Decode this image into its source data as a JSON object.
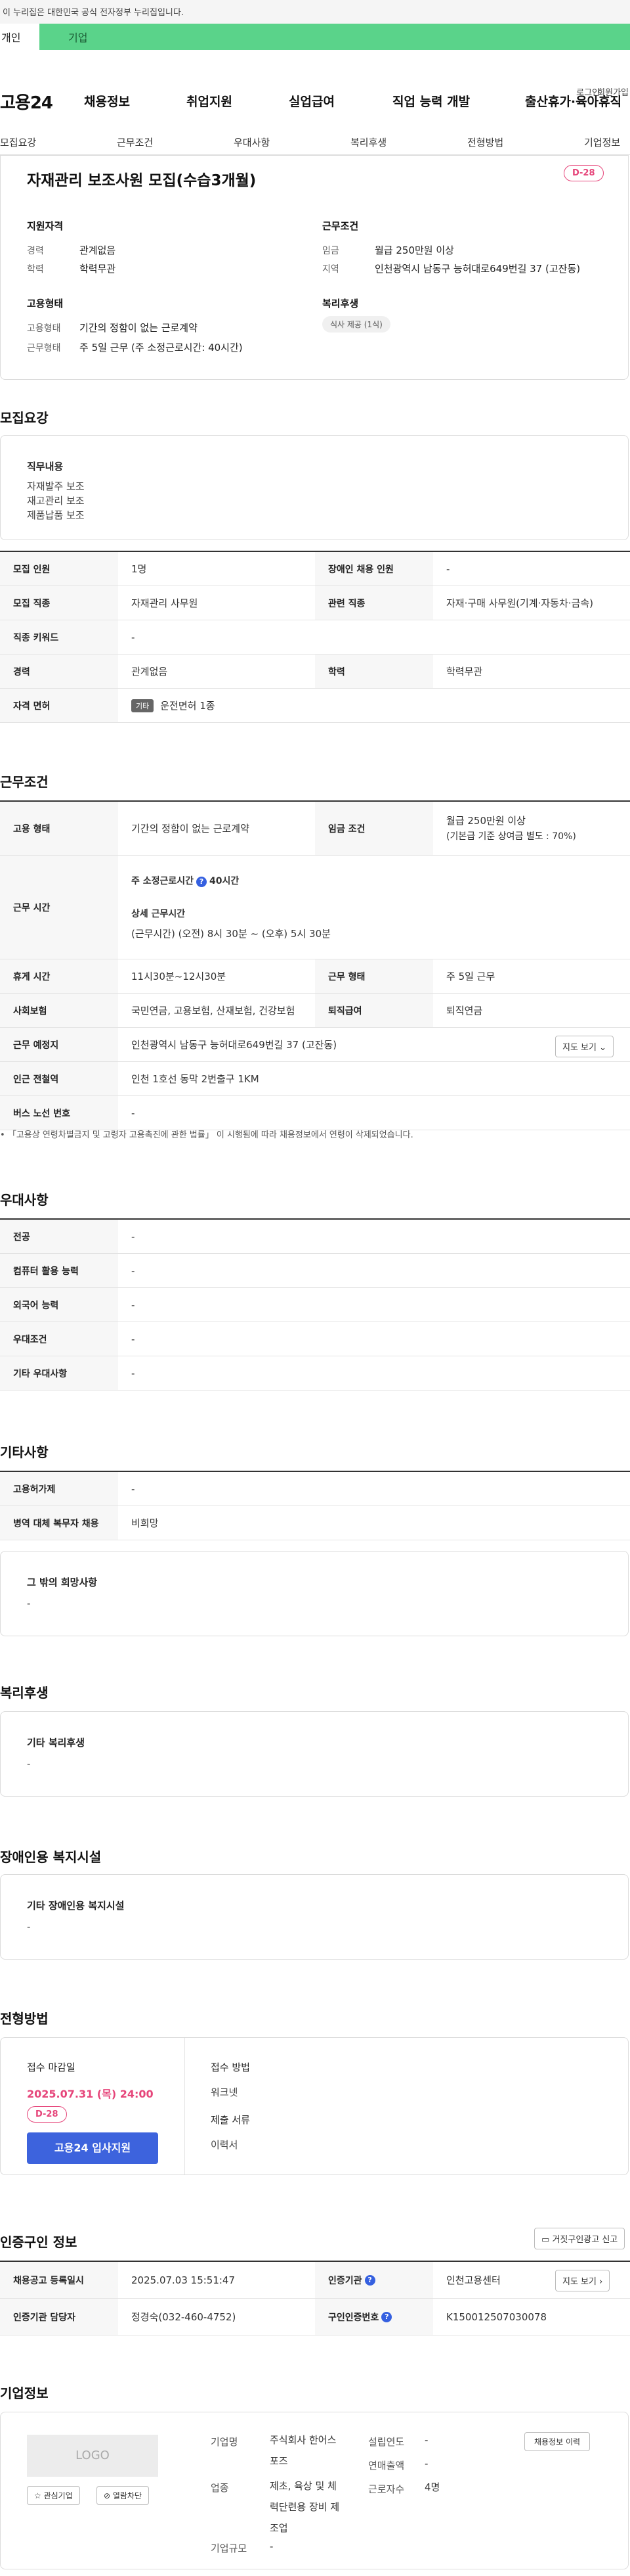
{
  "gov_banner": "이 누리집은 대한민국 공식 전자정부 누리집입니다.",
  "tabs": {
    "personal": "개인",
    "company": "기업"
  },
  "util": {
    "login": "로그인",
    "signup": "회원가입"
  },
  "gnb": {
    "logo": "고용24",
    "menu": [
      "채용정보",
      "취업지원",
      "실업급여",
      "직업 능력 개발",
      "출산휴가·육아휴직"
    ]
  },
  "subnav": [
    "모집요강",
    "근무조건",
    "우대사항",
    "복리후생",
    "전형방법",
    "기업정보"
  ],
  "summary": {
    "title": "자재관리 보조사원 모집(수습3개월)",
    "dday": "D-28",
    "qual_label": "지원자격",
    "qual": [
      {
        "k": "경력",
        "v": "관계없음"
      },
      {
        "k": "학력",
        "v": "학력무관"
      }
    ],
    "cond_label": "근무조건",
    "cond": [
      {
        "k": "임금",
        "v": "월급 250만원 이상"
      },
      {
        "k": "지역",
        "v": "인천광역시 남동구 능허대로649번길 37 (고잔동)"
      }
    ],
    "emp_label": "고용형태",
    "emp": [
      {
        "k": "고용형태",
        "v": "기간의 정함이 없는 근로계약"
      },
      {
        "k": "근무형태",
        "v": "주 5일 근무 (주 소정근로시간: 40시간)"
      }
    ],
    "welfare_label": "복리후생",
    "welfare_chip": "식사 제공 (1식)"
  },
  "recruit": {
    "title": "모집요강",
    "duty_label": "직무내용",
    "duties": [
      "자재발주 보조",
      "재고관리 보조",
      "제품납품 보조"
    ],
    "rows": [
      {
        "th1": "모집 인원",
        "td1": "1명",
        "th2": "장애인 채용 인원",
        "td2": "-"
      },
      {
        "th1": "모집 직종",
        "td1": "자재관리 사무원",
        "th2": "관련 직종",
        "td2": "자재·구매 사무원(기계·자동차·금속)"
      },
      {
        "th1": "직종 키워드",
        "td1": "-"
      },
      {
        "th1": "경력",
        "td1": "관계없음",
        "th2": "학력",
        "td2": "학력무관"
      },
      {
        "th1": "자격 면허",
        "tag": "기타",
        "td1": "운전면허 1종"
      }
    ]
  },
  "work": {
    "title": "근무조건",
    "emp_type_th": "고용 형태",
    "emp_type_td": "기간의 정함이 없는 근로계약",
    "wage_th": "임금 조건",
    "wage_1": "월급 250만원 이상",
    "wage_2": "(기본급 기준 상여금 별도 : 70%)",
    "hours_th": "근무 시간",
    "hours_label": "주 소정근로시간",
    "hours_value": "40시간",
    "hours_detail_label": "상세 근무시간",
    "hours_detail": "(근무시간) (오전) 8시 30분 ~ (오후) 5시 30분",
    "break_th": "휴게 시간",
    "break_td": "11시30분~12시30분",
    "form_th": "근무 형태",
    "form_td": "주 5일 근무",
    "ins_th": "사회보험",
    "ins_td": "국민연금, 고용보험, 산재보험, 건강보험",
    "ret_th": "퇴직급여",
    "ret_td": "퇴직연금",
    "place_th": "근무 예정지",
    "place_td": "인천광역시 남동구 능허대로649번길 37 (고잔동)",
    "map_btn": "지도 보기",
    "station_th": "인근 전철역",
    "station_td": "인천 1호선 동막 2번출구 1KM",
    "bus_th": "버스 노선 번호",
    "bus_td": "-",
    "note": "「고용상 연령차별금지 및 고령자 고용촉진에 관한 법률」 이 시행됨에 따라 채용정보에서 연령이 삭제되었습니다."
  },
  "pref": {
    "title": "우대사항",
    "rows": [
      {
        "th": "전공",
        "td": "-"
      },
      {
        "th": "컴퓨터 활용 능력",
        "td": "-"
      },
      {
        "th": "외국어 능력",
        "td": "-"
      },
      {
        "th": "우대조건",
        "td": "-"
      },
      {
        "th": "기타 우대사항",
        "td": "-"
      }
    ]
  },
  "etc": {
    "title": "기타사항",
    "rows": [
      {
        "th": "고용허가제",
        "td": "-"
      },
      {
        "th": "병역 대체 복무자 채용",
        "td": "비희망"
      }
    ],
    "hope_label": "그 밖의 희망사항",
    "hope_text": "-"
  },
  "welfare": {
    "title": "복리후생",
    "label": "기타 복리후생",
    "text": "-"
  },
  "disability": {
    "title": "장애인용 복지시설",
    "label": "기타 장애인용 복지시설",
    "text": "-"
  },
  "screening": {
    "title": "전형방법",
    "deadline_label": "접수 마감일",
    "deadline": "2025.07.31 (목) 24:00",
    "dday": "D-28",
    "apply_btn": "고용24 입사지원",
    "method_label": "접수 방법",
    "method": "워크넷",
    "docs_label": "제출 서류",
    "docs": "이력서"
  },
  "cert": {
    "title": "인증구인 정보",
    "report_btn": "거짓구인광고 신고",
    "reg_th": "채용공고 등록일시",
    "reg_td": "2025.07.03 15:51:47",
    "org_th": "인증기관",
    "org_td": "인천고용센터",
    "map_btn": "지도 보기",
    "mgr_th": "인증기관 담당자",
    "mgr_td": "정경숙(032-460-4752)",
    "no_th": "구인인증번호",
    "no_td": "K150012507030078"
  },
  "company": {
    "title": "기업정보",
    "logo": "LOGO",
    "interest_btn": "관심기업",
    "block_btn": "열람차단",
    "history_btn": "채용정보 이력",
    "name_k": "기업명",
    "name_v": "주식회사 한어스포즈",
    "ind_k": "업종",
    "ind_v": "제초, 육상 및 체력단련용 장비 제조업",
    "size_k": "기업규모",
    "size_v": "-",
    "est_k": "설립연도",
    "est_v": "-",
    "sales_k": "연매출액",
    "sales_v": "-",
    "emp_k": "근로자수",
    "emp_v": "4명"
  },
  "colors": {
    "accent_green": "#5ad38a",
    "accent_blue": "#3d63dd",
    "dday_pink": "#e6457a"
  }
}
